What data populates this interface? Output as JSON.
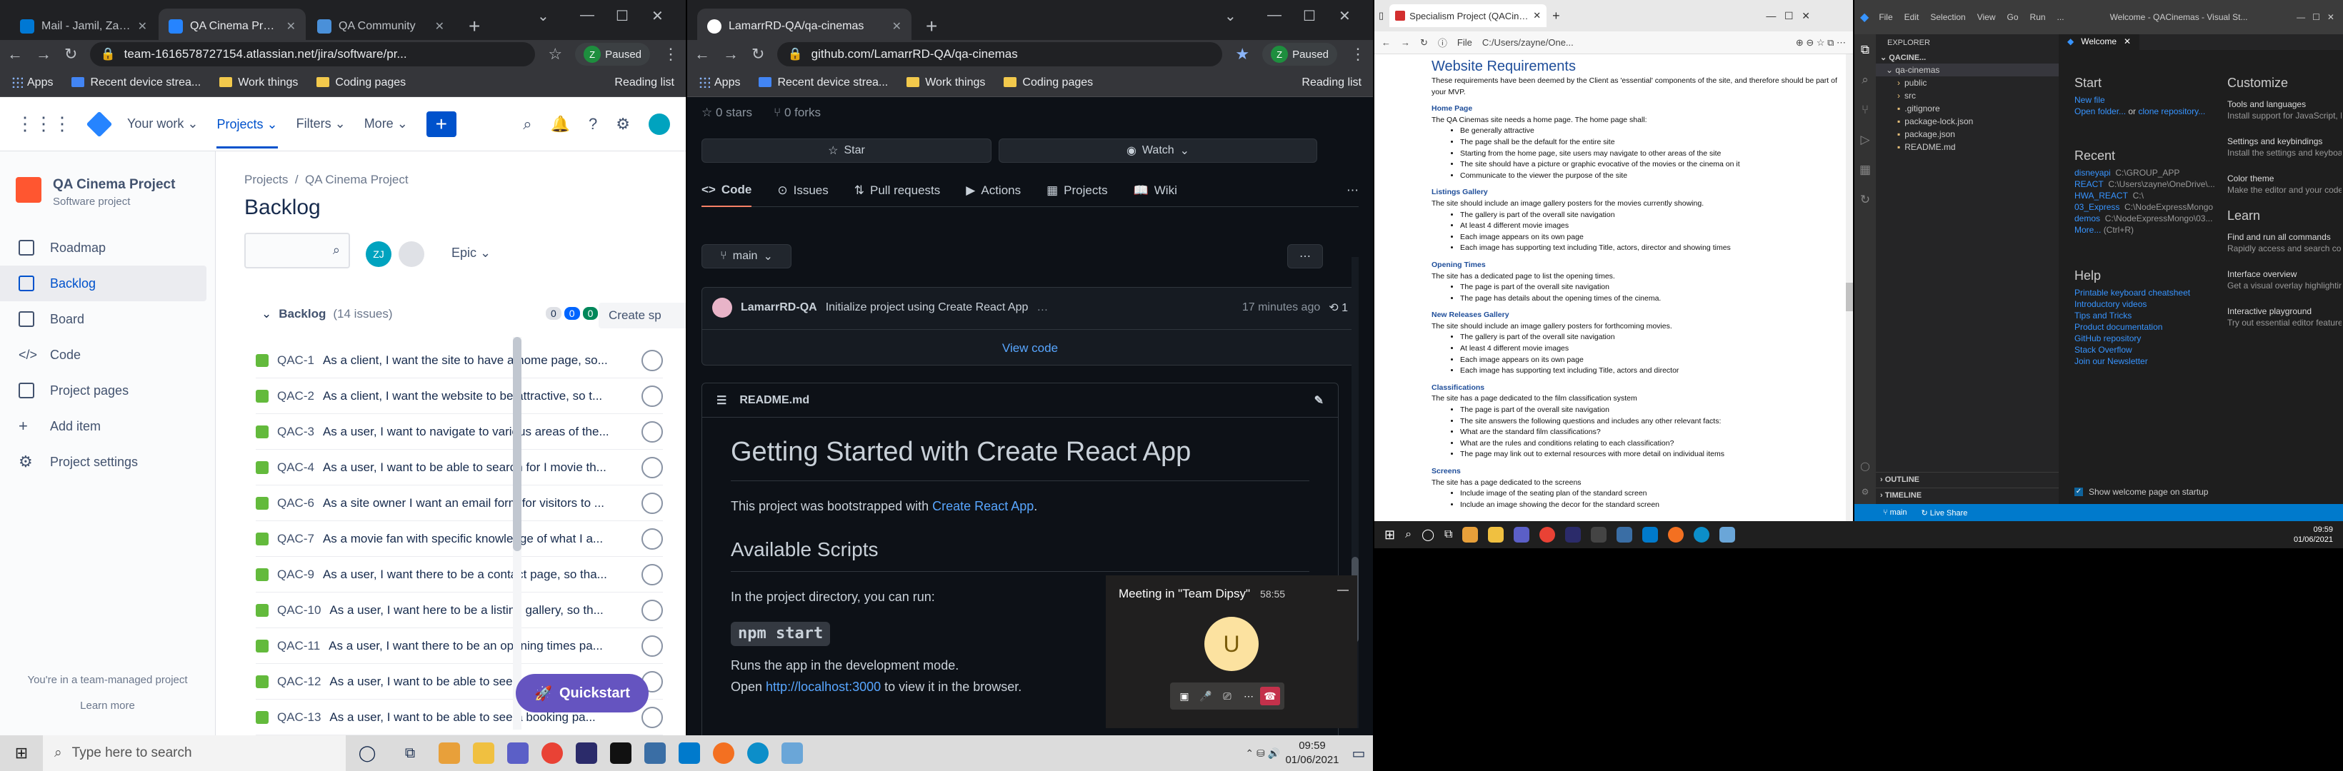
{
  "jira_window": {
    "tabs": [
      {
        "title": "Mail - Jamil, Zayne",
        "icon": "outlook-icon"
      },
      {
        "title": "QA Cinema Project",
        "icon": "jira-icon"
      },
      {
        "title": "QA Community",
        "icon": "qa-icon"
      }
    ],
    "url": "team-1616578727154.atlassian.net/jira/software/pr...",
    "paused": "Paused",
    "bookmarks": [
      "Apps",
      "Recent device strea...",
      "Work things",
      "Coding pages"
    ],
    "reading_list": "Reading list",
    "nav": {
      "your_work": "Your work",
      "projects": "Projects",
      "filters": "Filters",
      "more": "More"
    },
    "project_name": "QA Cinema Project",
    "project_type": "Software project",
    "sidebar": [
      "Roadmap",
      "Backlog",
      "Board",
      "Code",
      "Project pages",
      "Add item",
      "Project settings"
    ],
    "team_note": "You're in a team-managed project",
    "learn_more": "Learn more",
    "breadcrumb": [
      "Projects",
      "QA Cinema Project"
    ],
    "page_title": "Backlog",
    "epic": "Epic",
    "user_initials": "ZJ",
    "backlog_title": "Backlog",
    "issue_count": "(14 issues)",
    "counts": [
      "0",
      "0",
      "0"
    ],
    "create_sprint": "Create sp",
    "issues": [
      {
        "key": "QAC-1",
        "summary": "As a client, I want the site to have a home page, so..."
      },
      {
        "key": "QAC-2",
        "summary": "As a client, I want the website to be attractive, so t..."
      },
      {
        "key": "QAC-3",
        "summary": "As a user, I want to navigate to various areas of the..."
      },
      {
        "key": "QAC-4",
        "summary": "As a user, I want to be able to search for I movie th..."
      },
      {
        "key": "QAC-6",
        "summary": "As a site owner I want an email form for visitors to ..."
      },
      {
        "key": "QAC-7",
        "summary": "As a movie fan with specific knowledge of what I a..."
      },
      {
        "key": "QAC-9",
        "summary": "As a user, I want there to be a contact page, so tha..."
      },
      {
        "key": "QAC-10",
        "summary": "As a user, I want here to be a listing gallery, so th..."
      },
      {
        "key": "QAC-11",
        "summary": "As a user, I want there to be an opening times pa..."
      },
      {
        "key": "QAC-12",
        "summary": "As a user, I want to be able to see an image gall..."
      },
      {
        "key": "QAC-13",
        "summary": "As a user, I want to be able to see a booking pa..."
      }
    ],
    "quickstart": "Quickstart"
  },
  "github_window": {
    "tab": "LamarrRD-QA/qa-cinemas",
    "url": "github.com/LamarrRD-QA/qa-cinemas",
    "paused": "Paused",
    "bookmarks": [
      "Apps",
      "Recent device strea...",
      "Work things",
      "Coding pages"
    ],
    "reading_list": "Reading list",
    "stars": "0 stars",
    "forks": "0 forks",
    "star_btn": "Star",
    "watch_btn": "Watch",
    "tabs": [
      "Code",
      "Issues",
      "Pull requests",
      "Actions",
      "Projects",
      "Wiki"
    ],
    "branch": "main",
    "commit_author": "LamarrRD-QA",
    "commit_msg": "Initialize project using Create React App",
    "commit_time": "17 minutes ago",
    "commit_count": "1",
    "view_code": "View code",
    "readme_file": "README.md",
    "h1": "Getting Started with Create React App",
    "p1_pre": "This project was bootstrapped with ",
    "p1_link": "Create React App",
    ".": ".",
    "h2": "Available Scripts",
    "p2": "In the project directory, you can run:",
    "cmd": "npm start",
    "p3": "Runs the app in the development mode.",
    "p4_pre": "Open ",
    "p4_link": "http://localhost:3000",
    "p4_post": " to view it in the browser."
  },
  "teams": {
    "title": "Meeting in \"Team Dipsy\"",
    "timer": "58:55",
    "avatar": "U"
  },
  "word_window": {
    "tab": "Specialism Project (QACinemas)",
    "url": "C:/Users/zayne/One...",
    "file_label": "File",
    "title": "Website Requirements",
    "intro": "These requirements have been deemed by the Client as 'essential' components of the site, and therefore should be part of your MVP.",
    "sections": [
      {
        "h": "Home Page",
        "p": "The QA Cinemas site needs a home page. The home page shall:",
        "items": [
          "Be generally attractive",
          "The page shall be the default for the entire site",
          "Starting from the home page, site users may navigate to other areas of the site",
          "The site should have a picture or graphic evocative of the movies or the cinema on it",
          "Communicate to the viewer the purpose of the site"
        ]
      },
      {
        "h": "Listings Gallery",
        "p": "The site should include an image gallery posters for the movies currently showing.",
        "items": [
          "The gallery is part of the overall site navigation",
          "At least 4 different movie images",
          "Each image appears on its own page",
          "Each image has supporting text including Title, actors, director and showing times"
        ]
      },
      {
        "h": "Opening Times",
        "p": "The site has a dedicated page to list the opening times.",
        "items": [
          "The page is part of the overall site navigation",
          "The page has details about the opening times of the cinema."
        ]
      },
      {
        "h": "New Releases Gallery",
        "p": "The site should include an image gallery posters for forthcoming movies.",
        "items": [
          "The gallery is part of the overall site navigation",
          "At least 4 different movie images",
          "Each image appears on its own page",
          "Each image has supporting text including Title, actors and director"
        ]
      },
      {
        "h": "Classifications",
        "p": "The site has a page dedicated to the film classification system",
        "items": [
          "The page is part of the overall site navigation",
          "The site answers the following questions and includes any other relevant facts:",
          "What are the standard film classifications?",
          "What are the rules and conditions relating to each classification?",
          "The page may link out to external resources with more detail on individual items"
        ]
      },
      {
        "h": "Screens",
        "p": "The site has a page dedicated to the screens",
        "items": [
          "Include image of the seating plan of the standard screen",
          "Include an image showing the decor for the standard screen"
        ]
      }
    ]
  },
  "vscode_window": {
    "menu": [
      "File",
      "Edit",
      "Selection",
      "View",
      "Go",
      "Run",
      "..."
    ],
    "title": "Welcome - QACinemas - Visual St...",
    "tab": "Welcome",
    "explorer": "EXPLORER",
    "root": "QACINE...",
    "folder": "qa-cinemas",
    "files": [
      "public",
      "src",
      ".gitignore",
      "package-lock.json",
      "package.json",
      "README.md"
    ],
    "outline": "OUTLINE",
    "timeline": "TIMELINE",
    "start": "Start",
    "new_file": "New file",
    "open_folder": "Open folder...",
    "or": " or ",
    "clone": "clone repository...",
    "recent": "Recent",
    "recent_items": [
      {
        "n": "disneyapi",
        "p": "C:\\GROUP_APP"
      },
      {
        "n": "REACT",
        "p": "C:\\Users\\zayne\\OneDrive\\..."
      },
      {
        "n": "HWA_REACT",
        "p": "C:\\"
      },
      {
        "n": "03_Express",
        "p": "C:\\NodeExpressMongo"
      },
      {
        "n": "demos",
        "p": "C:\\NodeExpressMongo\\03..."
      }
    ],
    "more": "More...",
    "more_key": "(Ctrl+R)",
    "help": "Help",
    "help_items": [
      "Printable keyboard cheatsheet",
      "Introductory videos",
      "Tips and Tricks",
      "Product documentation",
      "GitHub repository",
      "Stack Overflow",
      "Join our Newsletter"
    ],
    "customize": "Customize",
    "cust_items": [
      {
        "t": "Tools and languages",
        "d": "Install support for JavaScript, Py..."
      },
      {
        "t": "Settings and keybindings",
        "d": "Install the settings and keyboar..."
      },
      {
        "t": "Color theme",
        "d": "Make the editor and your code ..."
      }
    ],
    "learn": "Learn",
    "learn_items": [
      {
        "t": "Find and run all commands",
        "d": "Rapidly access and search com..."
      },
      {
        "t": "Interface overview",
        "d": "Get a visual overlay highlightin..."
      },
      {
        "t": "Interactive playground",
        "d": "Try out essential editor features ..."
      }
    ],
    "show_welcome": "Show welcome page on startup",
    "status_branch": "main",
    "status_live": "Live Share"
  },
  "taskbar_main": {
    "search": "Type here to search",
    "time": "09:59",
    "date": "01/06/2021"
  },
  "taskbar_side": {
    "time": "09:59",
    "date": "01/06/2021"
  }
}
